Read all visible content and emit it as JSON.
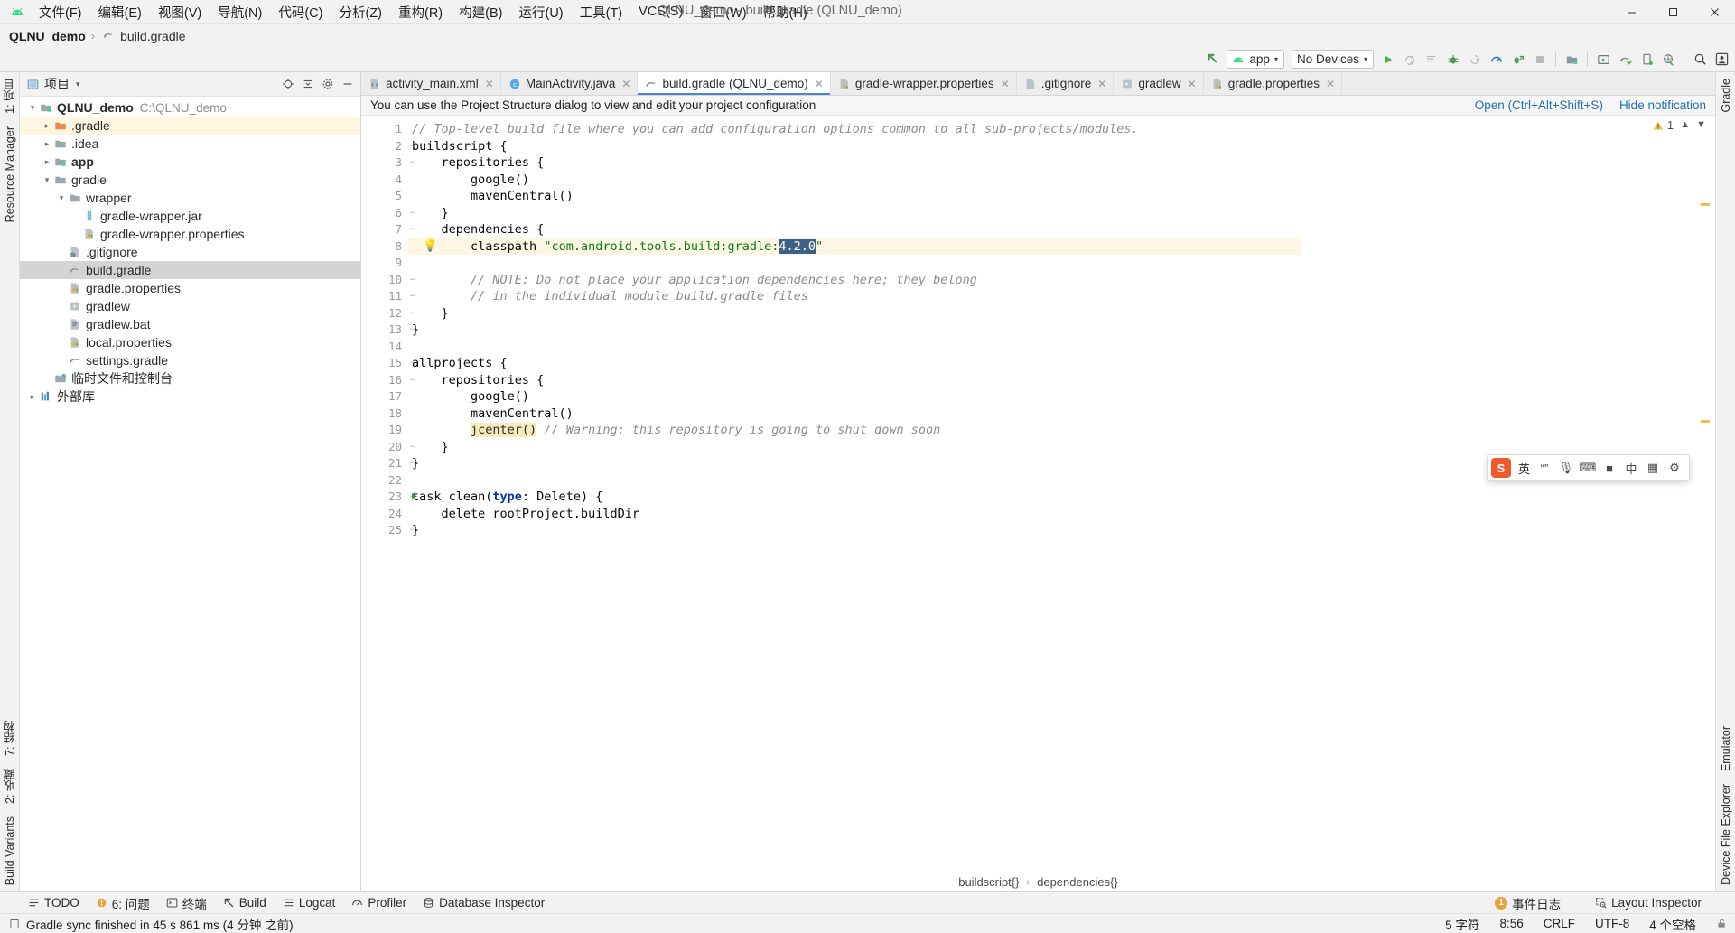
{
  "window": {
    "title": "QLNU_demo - build.gradle (QLNU_demo)",
    "minimize": "─",
    "maximize": "☐",
    "close": "✕"
  },
  "menu": {
    "items": [
      {
        "label": "文件(F)",
        "name": "menu-file"
      },
      {
        "label": "编辑(E)",
        "name": "menu-edit"
      },
      {
        "label": "视图(V)",
        "name": "menu-view"
      },
      {
        "label": "导航(N)",
        "name": "menu-navigate"
      },
      {
        "label": "代码(C)",
        "name": "menu-code"
      },
      {
        "label": "分析(Z)",
        "name": "menu-analyze"
      },
      {
        "label": "重构(R)",
        "name": "menu-refactor"
      },
      {
        "label": "构建(B)",
        "name": "menu-build"
      },
      {
        "label": "运行(U)",
        "name": "menu-run"
      },
      {
        "label": "工具(T)",
        "name": "menu-tools"
      },
      {
        "label": "VCS(S)",
        "name": "menu-vcs"
      },
      {
        "label": "窗口(W)",
        "name": "menu-window"
      },
      {
        "label": "帮助(H)",
        "name": "menu-help"
      }
    ]
  },
  "breadcrumb": {
    "project": "QLNU_demo",
    "separator": "›",
    "file": "build.gradle"
  },
  "toolbar": {
    "module_selector": "app",
    "device_selector": "No Devices",
    "caret": "▾",
    "buttons": [
      {
        "name": "run-button",
        "title": "Run"
      },
      {
        "name": "apply-changes-icon",
        "title": "Apply Changes"
      },
      {
        "name": "apply-code-changes-icon",
        "title": "Apply Code Changes"
      },
      {
        "name": "debug-button",
        "title": "Debug"
      },
      {
        "name": "attach-debugger-icon",
        "title": "Attach Debugger"
      },
      {
        "name": "profiler-icon",
        "title": "Profiler"
      },
      {
        "name": "run-with-coverage-icon",
        "title": "Run with Coverage"
      },
      {
        "name": "stop-button",
        "title": "Stop"
      },
      {
        "name": "sdk-manager-icon",
        "title": "SDK Manager"
      },
      {
        "name": "avd-manager-icon",
        "title": "AVD Manager"
      },
      {
        "name": "sync-gradle-icon",
        "title": "Sync Project with Gradle Files"
      },
      {
        "name": "device-file-explorer-icon",
        "title": "Device File Explorer"
      },
      {
        "name": "layout-inspector-icon",
        "title": "Layout Inspector"
      },
      {
        "name": "search-everywhere-icon",
        "title": "Search Everywhere"
      },
      {
        "name": "account-icon",
        "title": "Account"
      }
    ]
  },
  "project_panel": {
    "title": "项目",
    "caret": "▾",
    "header_icons": [
      {
        "name": "locate-icon"
      },
      {
        "name": "collapse-all-icon"
      },
      {
        "name": "settings-gear-icon"
      },
      {
        "name": "hide-panel-icon"
      }
    ],
    "tree": [
      {
        "depth": 0,
        "arrow": "⌄",
        "icon": "module-icon",
        "label": "QLNU_demo",
        "bold": true,
        "path": "C:\\QLNU_demo",
        "state": "normal"
      },
      {
        "depth": 1,
        "arrow": "›",
        "icon": "folder-orange-icon",
        "label": ".gradle",
        "bold": false,
        "path": "",
        "state": "highlight"
      },
      {
        "depth": 1,
        "arrow": "›",
        "icon": "folder-icon",
        "label": ".idea",
        "bold": false,
        "path": "",
        "state": "normal"
      },
      {
        "depth": 1,
        "arrow": "›",
        "icon": "module-icon",
        "label": "app",
        "bold": true,
        "path": "",
        "state": "normal"
      },
      {
        "depth": 1,
        "arrow": "⌄",
        "icon": "folder-icon",
        "label": "gradle",
        "bold": false,
        "path": "",
        "state": "normal"
      },
      {
        "depth": 2,
        "arrow": "⌄",
        "icon": "folder-icon",
        "label": "wrapper",
        "bold": false,
        "path": "",
        "state": "normal"
      },
      {
        "depth": 3,
        "arrow": "",
        "icon": "jar-icon",
        "label": "gradle-wrapper.jar",
        "bold": false,
        "path": "",
        "state": "normal"
      },
      {
        "depth": 3,
        "arrow": "",
        "icon": "properties-icon",
        "label": "gradle-wrapper.properties",
        "bold": false,
        "path": "",
        "state": "normal"
      },
      {
        "depth": 2,
        "arrow": "",
        "icon": "gitignore-icon",
        "label": ".gitignore",
        "bold": false,
        "path": "",
        "state": "normal"
      },
      {
        "depth": 2,
        "arrow": "",
        "icon": "gradle-icon",
        "label": "build.gradle",
        "bold": false,
        "path": "",
        "state": "selected"
      },
      {
        "depth": 2,
        "arrow": "",
        "icon": "properties-icon",
        "label": "gradle.properties",
        "bold": false,
        "path": "",
        "state": "normal"
      },
      {
        "depth": 2,
        "arrow": "",
        "icon": "script-icon",
        "label": "gradlew",
        "bold": false,
        "path": "",
        "state": "normal"
      },
      {
        "depth": 2,
        "arrow": "",
        "icon": "bat-icon",
        "label": "gradlew.bat",
        "bold": false,
        "path": "",
        "state": "normal"
      },
      {
        "depth": 2,
        "arrow": "",
        "icon": "properties-icon",
        "label": "local.properties",
        "bold": false,
        "path": "",
        "state": "normal"
      },
      {
        "depth": 2,
        "arrow": "",
        "icon": "gradle-icon",
        "label": "settings.gradle",
        "bold": false,
        "path": "",
        "state": "normal"
      },
      {
        "depth": 1,
        "arrow": "",
        "icon": "scratch-icon",
        "label": "临时文件和控制台",
        "bold": false,
        "path": "",
        "state": "normal"
      },
      {
        "depth": 0,
        "arrow": "›",
        "icon": "library-icon",
        "label": "外部库",
        "bold": false,
        "path": "",
        "state": "normal"
      }
    ]
  },
  "left_rail": {
    "top": [
      {
        "label": "1: 项目",
        "name": "rail-project"
      },
      {
        "label": "Resource Manager",
        "name": "rail-resource-manager"
      }
    ],
    "bottom": [
      {
        "label": "7: 结构",
        "name": "rail-structure"
      },
      {
        "label": "2: 收藏",
        "name": "rail-favorites"
      },
      {
        "label": "Build Variants",
        "name": "rail-build-variants"
      }
    ]
  },
  "right_rail": {
    "items": [
      {
        "label": "Gradle",
        "name": "rail-gradle"
      },
      {
        "label": "Emulator",
        "name": "rail-emulator"
      },
      {
        "label": "Device File Explorer",
        "name": "rail-device-file-explorer"
      }
    ]
  },
  "editor_tabs": [
    {
      "label": "activity_main.xml",
      "icon": "xml-file-icon",
      "active": false
    },
    {
      "label": "MainActivity.java",
      "icon": "java-class-icon",
      "active": false
    },
    {
      "label": "build.gradle (QLNU_demo)",
      "icon": "gradle-file-icon",
      "active": true
    },
    {
      "label": "gradle-wrapper.properties",
      "icon": "properties-file-icon",
      "active": false
    },
    {
      "label": ".gitignore",
      "icon": "gitignore-file-icon",
      "active": false
    },
    {
      "label": "gradlew",
      "icon": "script-file-icon",
      "active": false
    },
    {
      "label": "gradle.properties",
      "icon": "properties-file-icon",
      "active": false
    }
  ],
  "notification": {
    "message": "You can use the Project Structure dialog to view and edit your project configuration",
    "open_link": "Open (Ctrl+Alt+Shift+S)",
    "hide_link": "Hide notification"
  },
  "editor": {
    "first_line": 1,
    "line_count": 25,
    "selection": "4.2.0",
    "lines": [
      {
        "n": 1,
        "fold": "",
        "tokens": [
          {
            "t": "// Top-level build file where you can add configuration options common to all sub-projects/modules.",
            "c": "com"
          }
        ]
      },
      {
        "n": 2,
        "fold": "-",
        "tokens": [
          {
            "t": "buildscript {",
            "c": "plain"
          }
        ]
      },
      {
        "n": 3,
        "fold": "-",
        "tokens": [
          {
            "t": "    repositories {",
            "c": "plain"
          }
        ]
      },
      {
        "n": 4,
        "fold": "",
        "tokens": [
          {
            "t": "        google()",
            "c": "plain"
          }
        ]
      },
      {
        "n": 5,
        "fold": "",
        "tokens": [
          {
            "t": "        mavenCentral()",
            "c": "plain"
          }
        ]
      },
      {
        "n": 6,
        "fold": "-",
        "tokens": [
          {
            "t": "    }",
            "c": "plain"
          }
        ]
      },
      {
        "n": 7,
        "fold": "-",
        "tokens": [
          {
            "t": "    dependencies {",
            "c": "plain"
          }
        ]
      },
      {
        "n": 8,
        "fold": "",
        "bulb": true,
        "hl": true,
        "tokens": [
          {
            "t": "        classpath ",
            "c": "plain"
          },
          {
            "t": "\"com.android.tools.build:gradle:",
            "c": "str"
          },
          {
            "t": "4.2.0",
            "c": "sel"
          },
          {
            "t": "\"",
            "c": "str"
          }
        ]
      },
      {
        "n": 9,
        "fold": "",
        "tokens": [
          {
            "t": "",
            "c": "plain"
          }
        ]
      },
      {
        "n": 10,
        "fold": "-",
        "tokens": [
          {
            "t": "        // NOTE: Do not place your application dependencies here; they belong",
            "c": "com"
          }
        ]
      },
      {
        "n": 11,
        "fold": "-",
        "tokens": [
          {
            "t": "        // in the individual module build.gradle files",
            "c": "com"
          }
        ]
      },
      {
        "n": 12,
        "fold": "-",
        "tokens": [
          {
            "t": "    }",
            "c": "plain"
          }
        ]
      },
      {
        "n": 13,
        "fold": "-",
        "tokens": [
          {
            "t": "}",
            "c": "plain"
          }
        ]
      },
      {
        "n": 14,
        "fold": "",
        "tokens": [
          {
            "t": "",
            "c": "plain"
          }
        ]
      },
      {
        "n": 15,
        "fold": "-",
        "tokens": [
          {
            "t": "allprojects {",
            "c": "plain"
          }
        ]
      },
      {
        "n": 16,
        "fold": "-",
        "tokens": [
          {
            "t": "    repositories {",
            "c": "plain"
          }
        ]
      },
      {
        "n": 17,
        "fold": "",
        "tokens": [
          {
            "t": "        google()",
            "c": "plain"
          }
        ]
      },
      {
        "n": 18,
        "fold": "",
        "tokens": [
          {
            "t": "        mavenCentral()",
            "c": "plain"
          }
        ]
      },
      {
        "n": 19,
        "fold": "",
        "tokens": [
          {
            "t": "        ",
            "c": "plain"
          },
          {
            "t": "jcenter()",
            "c": "warn"
          },
          {
            "t": " // Warning: this repository is going to shut down soon",
            "c": "com"
          }
        ]
      },
      {
        "n": 20,
        "fold": "-",
        "tokens": [
          {
            "t": "    }",
            "c": "plain"
          }
        ]
      },
      {
        "n": 21,
        "fold": "-",
        "tokens": [
          {
            "t": "}",
            "c": "plain"
          }
        ]
      },
      {
        "n": 22,
        "fold": "",
        "tokens": [
          {
            "t": "",
            "c": "plain"
          }
        ]
      },
      {
        "n": 23,
        "fold": "-",
        "run": true,
        "tokens": [
          {
            "t": "task clean(",
            "c": "plain"
          },
          {
            "t": "type",
            "c": "kw"
          },
          {
            "t": ": Delete) {",
            "c": "plain"
          }
        ]
      },
      {
        "n": 24,
        "fold": "",
        "tokens": [
          {
            "t": "    delete rootProject.buildDir",
            "c": "plain"
          }
        ]
      },
      {
        "n": 25,
        "fold": "-",
        "tokens": [
          {
            "t": "}",
            "c": "plain"
          }
        ]
      }
    ],
    "warning_count": "1",
    "footer_breadcrumb": [
      "buildscript{}",
      "dependencies{}"
    ],
    "footer_sep": "›"
  },
  "ime_bar": {
    "logo": "S",
    "mode_label": "英",
    "icons": [
      {
        "name": "ime-punctuation-icon",
        "glyph": "“”"
      },
      {
        "name": "ime-voice-icon",
        "glyph": "🎙"
      },
      {
        "name": "ime-keyboard-icon",
        "glyph": "⌨"
      },
      {
        "name": "ime-emoji-icon",
        "glyph": "■"
      },
      {
        "name": "ime-translate-icon",
        "glyph": "中"
      },
      {
        "name": "ime-apps-icon",
        "glyph": "▦"
      },
      {
        "name": "ime-settings-icon",
        "glyph": "⚙"
      }
    ]
  },
  "tool_windows": {
    "left": [
      {
        "label": "TODO",
        "icon": "todo-icon",
        "name": "toolwindow-todo"
      },
      {
        "label": "6: 问题",
        "icon": "problems-icon",
        "name": "toolwindow-problems"
      },
      {
        "label": "终端",
        "icon": "terminal-icon",
        "name": "toolwindow-terminal"
      },
      {
        "label": "Build",
        "icon": "build-icon",
        "name": "toolwindow-build"
      },
      {
        "label": "Logcat",
        "icon": "logcat-icon",
        "name": "toolwindow-logcat"
      },
      {
        "label": "Profiler",
        "icon": "profiler-icon",
        "name": "toolwindow-profiler"
      },
      {
        "label": "Database Inspector",
        "icon": "database-icon",
        "name": "toolwindow-database-inspector"
      }
    ],
    "right": [
      {
        "label": "事件日志",
        "badge": "1",
        "name": "toolwindow-event-log"
      },
      {
        "label": "Layout Inspector",
        "badge": "",
        "name": "toolwindow-layout-inspector"
      }
    ]
  },
  "status_bar": {
    "message": "Gradle sync finished in 45 s 861 ms (4 分钟 之前)",
    "right": [
      {
        "label": "5 字符",
        "name": "status-selection"
      },
      {
        "label": "8:56",
        "name": "status-caret-position"
      },
      {
        "label": "CRLF",
        "name": "status-line-separator"
      },
      {
        "label": "UTF-8",
        "name": "status-encoding"
      },
      {
        "label": "4 个空格",
        "name": "status-indent"
      }
    ],
    "lock_icon": "lock-icon"
  },
  "colors": {
    "accent": "#4a86c8",
    "green": "#3ddc84",
    "warn": "#e8a33d",
    "selection": "#3d6185",
    "highlight_line": "#fdf6e3"
  }
}
